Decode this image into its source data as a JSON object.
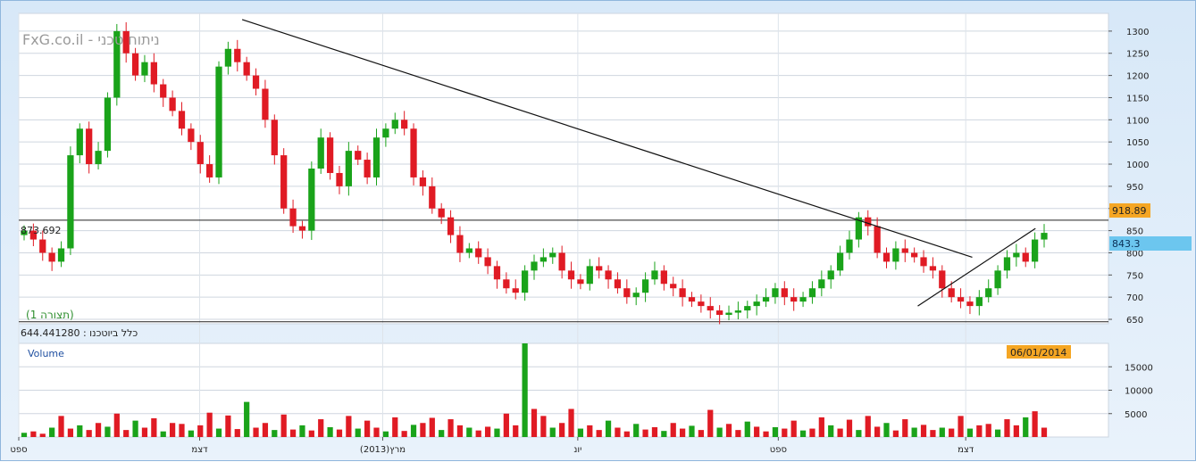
{
  "watermark": "FxG.co.il - ניתוח טכני",
  "pattern_label": "(תצורה 1)",
  "instrument_label": "כלל ביוטכנו : 644.441280",
  "level_labels": {
    "left": "873.692",
    "upper_right": "918.89",
    "current": "843.3"
  },
  "date_badge": "06/01/2014",
  "volume_label": "Volume",
  "colors": {
    "up": "#1aa31a",
    "down": "#e01b24",
    "current_badge": "#6cc6ef",
    "level_badge": "#f5a623",
    "grid": "#cfd6df"
  },
  "chart_data": [
    {
      "type": "candlestick",
      "yaxis_ticks": [
        650,
        700,
        750,
        800,
        850,
        900,
        950,
        1000,
        1050,
        1100,
        1150,
        1200,
        1250,
        1300
      ],
      "ylim": [
        640,
        1340
      ],
      "horizontal_levels": [
        873.692,
        644.441
      ],
      "last_value": 843.3,
      "resistance_value": 918.89,
      "trendlines": [
        {
          "name": "",
          "from": {
            "x": 0.205,
            "y": 1326
          },
          "to": {
            "x": 0.875,
            "y": 790
          }
        },
        {
          "name": "",
          "from": {
            "x": 0.825,
            "y": 680
          },
          "to": {
            "x": 0.933,
            "y": 855
          }
        }
      ],
      "x_tick_labels": [
        "ספט",
        "דצמ",
        "מרץ(2013)",
        "יונ",
        "ספט",
        "דצמ"
      ],
      "series_close": [
        850,
        830,
        800,
        780,
        810,
        1020,
        1080,
        1000,
        1030,
        1150,
        1300,
        1250,
        1200,
        1230,
        1180,
        1150,
        1120,
        1080,
        1050,
        1000,
        970,
        1220,
        1260,
        1230,
        1200,
        1170,
        1100,
        1020,
        900,
        860,
        850,
        990,
        1060,
        980,
        950,
        1030,
        1010,
        970,
        1060,
        1080,
        1100,
        1080,
        970,
        950,
        900,
        880,
        840,
        800,
        810,
        790,
        770,
        740,
        720,
        710,
        760,
        780,
        790,
        800,
        760,
        740,
        730,
        770,
        760,
        740,
        720,
        700,
        710,
        740,
        760,
        730,
        720,
        700,
        690,
        680,
        670,
        660,
        665,
        670,
        680,
        690,
        700,
        720,
        700,
        690,
        700,
        720,
        740,
        760,
        800,
        830,
        880,
        860,
        800,
        780,
        810,
        800,
        790,
        770,
        760,
        720,
        700,
        690,
        680,
        700,
        720,
        760,
        790,
        800,
        780,
        830,
        845
      ]
    },
    {
      "type": "bar",
      "name": "",
      "yaxis_ticks": [
        5000,
        10000,
        15000
      ],
      "ylim": [
        0,
        20000
      ],
      "values": [
        900,
        1200,
        700,
        2000,
        4500,
        1800,
        2500,
        1500,
        3000,
        2200,
        5000,
        1500,
        3500,
        2000,
        4000,
        1200,
        3000,
        2800,
        1400,
        2500,
        5200,
        1800,
        4600,
        1700,
        7500,
        2000,
        3000,
        1500,
        4800,
        1600,
        2500,
        1400,
        3800,
        2100,
        1600,
        4500,
        1800,
        3500,
        2000,
        1200,
        4200,
        1300,
        2600,
        3000,
        4100,
        1500,
        3800,
        2500,
        2000,
        1400,
        2200,
        1800,
        5000,
        2500,
        20000,
        6000,
        4500,
        2000,
        3000,
        6000,
        1800,
        2500,
        1500,
        3500,
        2000,
        1200,
        2800,
        1600,
        2100,
        1300,
        3000,
        1800,
        2400,
        1500,
        5800,
        2000,
        2800,
        1500,
        3300,
        2200,
        1200,
        2100,
        1800,
        3500,
        1400,
        1800,
        4200,
        2500,
        1800,
        3700,
        1500,
        4500,
        2200,
        3000,
        1400,
        3800,
        2000,
        2600,
        1500,
        2000,
        1800,
        4500,
        1800,
        2500,
        2800,
        1600,
        3800,
        2500,
        4200,
        5500,
        2000
      ]
    }
  ]
}
